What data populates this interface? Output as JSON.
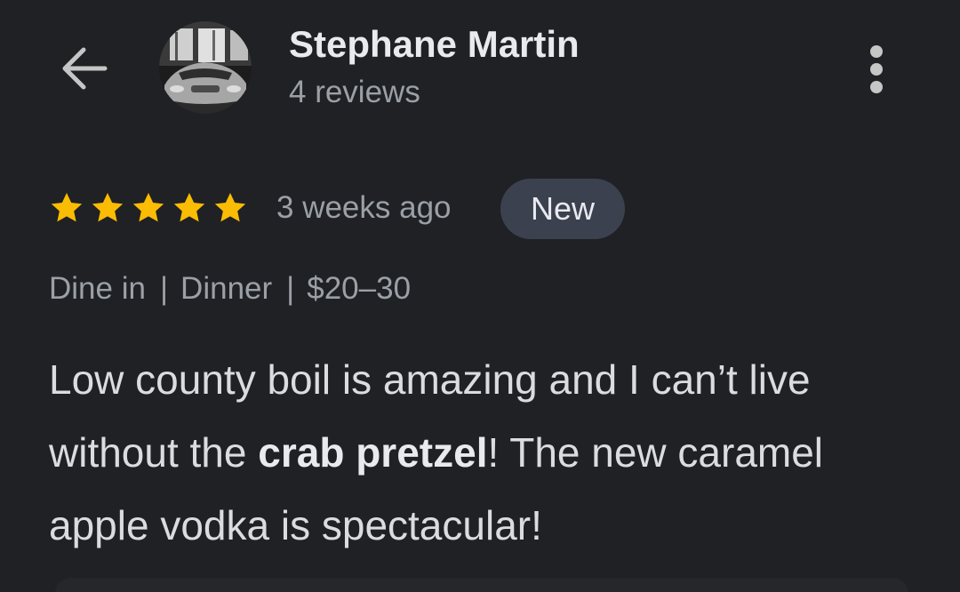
{
  "header": {
    "back_icon": "arrow-back-icon",
    "avatar_alt": "profile photo of a silver car in a showroom",
    "user_name": "Stephane Martin",
    "review_count": "4 reviews",
    "more_icon": "more-vert-icon"
  },
  "review": {
    "rating": 5,
    "rating_max": 5,
    "star_color": "#fbbc04",
    "time_ago": "3 weeks ago",
    "badge": "New",
    "attributes": [
      "Dine in",
      "Dinner",
      "$20–30"
    ],
    "separator": "|",
    "text_parts": [
      "Low county boil is amazing and I can’t live without the ",
      "crab pretzel",
      "! The new caramel apple vodka is spectacular!"
    ]
  },
  "colors": {
    "background": "#202124",
    "primary_text": "#e8eaed",
    "secondary_text": "#9aa0a6",
    "badge_bg": "#3c4150"
  }
}
